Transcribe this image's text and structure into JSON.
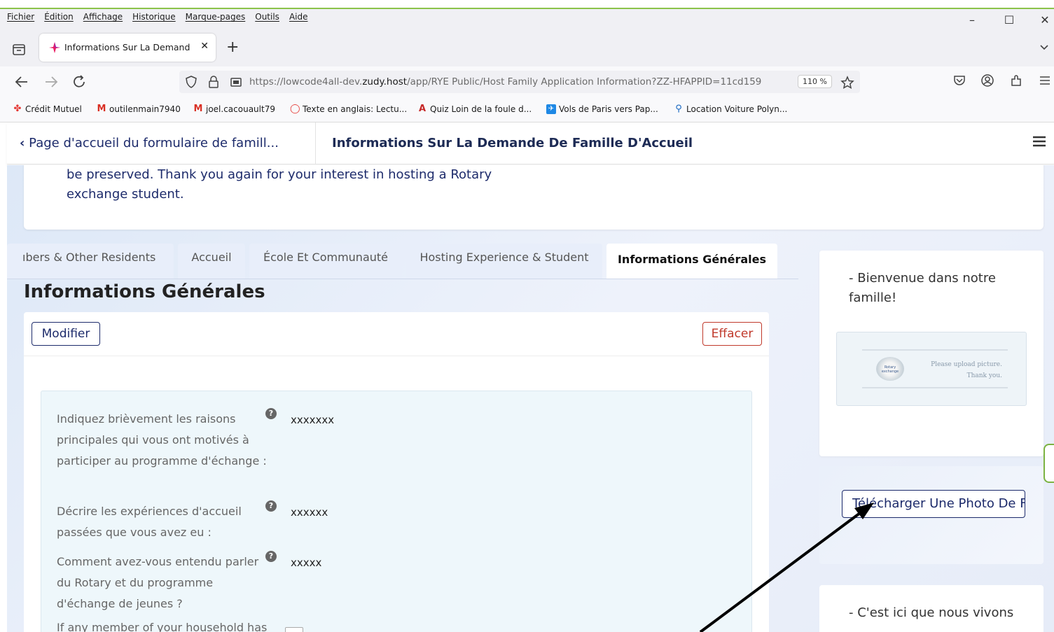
{
  "menu": [
    "Fichier",
    "Édition",
    "Affichage",
    "Historique",
    "Marque-pages",
    "Outils",
    "Aide"
  ],
  "window_controls": {
    "minimize": "–",
    "maximize": "☐",
    "close": "✕"
  },
  "browser_tab": {
    "title": "Informations Sur La Demande D",
    "close": "✕",
    "new": "+"
  },
  "nav": {
    "url_prefix": "https://lowcode4all-dev.",
    "url_domain": "zudy.host",
    "url_path": "/app/RYE Public/Host Family Application Information?ZZ-HFAPPID=11cd159",
    "zoom": "110 %"
  },
  "bookmarks": [
    {
      "label": "Crédit Mutuel",
      "icon": "credit-mutuel-icon",
      "color": "#e53935"
    },
    {
      "label": "outilenmain7940",
      "icon": "gmail-icon",
      "color": "#d93025"
    },
    {
      "label": "joel.cacouault79",
      "icon": "gmail-icon",
      "color": "#d93025"
    },
    {
      "label": "Texte en anglais: Lectu...",
      "icon": "opera-icon",
      "color": "#e53935"
    },
    {
      "label": "Quiz Loin de la foule d...",
      "icon": "font-icon",
      "color": "#c62828"
    },
    {
      "label": "Vols de Paris vers Pap...",
      "icon": "plane-icon",
      "color": "#1e88e5"
    },
    {
      "label": "Location Voiture Polyn...",
      "icon": "pin-icon",
      "color": "#1565c0"
    }
  ],
  "header": {
    "back_label": "Page d'accueil du formulaire de famill...",
    "title": "Informations Sur La Demande De Famille D'Accueil"
  },
  "intro": {
    "text": "be preserved. Thank you again for your interest in hosting a Rotary exchange student."
  },
  "tabs": [
    {
      "label": "ıbers & Other Residents",
      "active": false
    },
    {
      "label": "Accueil",
      "active": false
    },
    {
      "label": "École Et Communauté",
      "active": false
    },
    {
      "label": "Hosting Experience & Student",
      "active": false
    },
    {
      "label": "Informations Générales",
      "active": true
    }
  ],
  "section": {
    "title": "Informations Générales",
    "modify_label": "Modifier",
    "clear_label": "Effacer"
  },
  "fields": [
    {
      "label": "Indiquez brièvement les raisons principales qui vous ont motivés à participer au programme d'échange :",
      "value": "xxxxxxx"
    },
    {
      "label": "Décrire les expériences d'accueil passées que vous avez eu :",
      "value": "xxxxxx"
    },
    {
      "label": "Comment avez-vous entendu parler du Rotary et du programme d'échange de jeunes ?",
      "value": "xxxxx"
    },
    {
      "label": "If any member of your household has",
      "value": ""
    }
  ],
  "sidebar": {
    "welcome": "- Bienvenue dans notre famille!",
    "photo_msg_line1": "Please upload picture.",
    "photo_msg_line2": "Thank you.",
    "logo_text": "Rotary exchange",
    "upload_label": "Télécharger Une Photo De Famille",
    "here_we_live": "- C'est ici que nous vivons"
  }
}
